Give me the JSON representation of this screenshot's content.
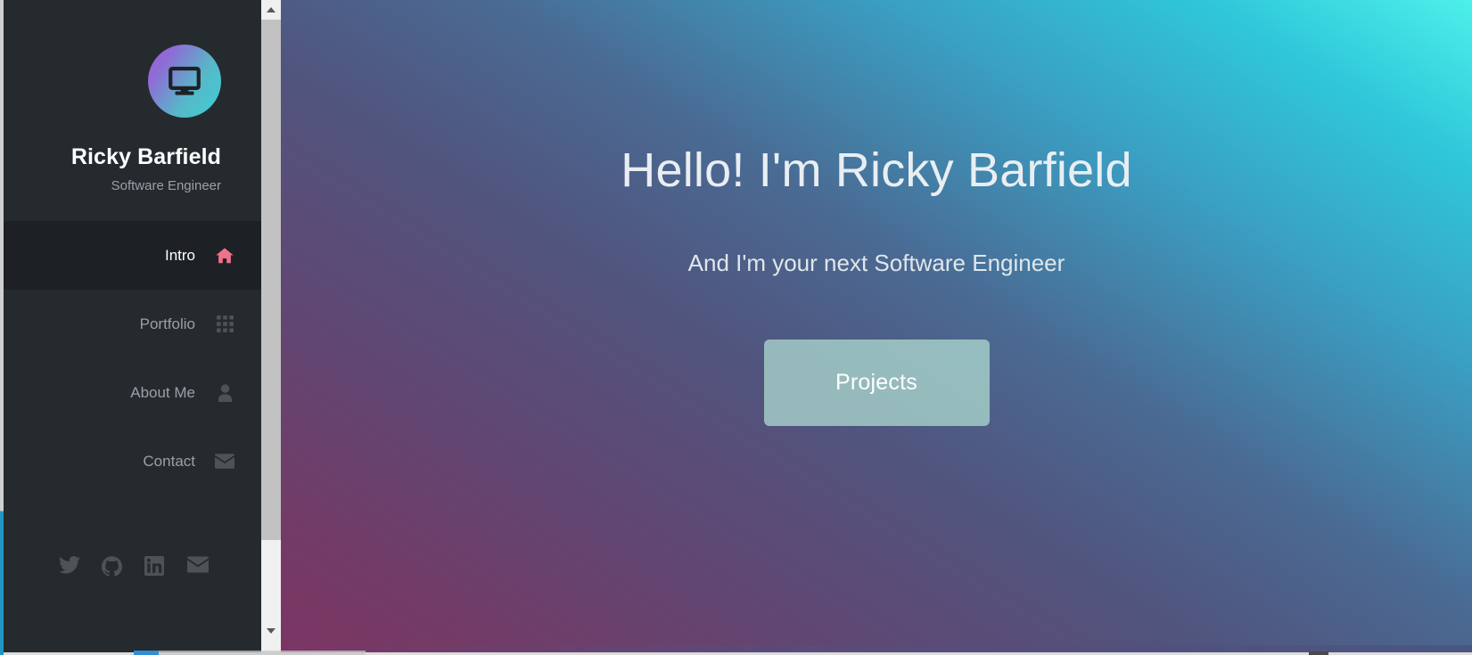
{
  "profile": {
    "name": "Ricky Barfield",
    "role": "Software Engineer",
    "avatar_icon": "desktop-monitor-icon",
    "avatar_gradient_from": "#a15fd0",
    "avatar_gradient_to": "#3ecfd4"
  },
  "nav": {
    "items": [
      {
        "label": "Intro",
        "icon": "home-icon",
        "active": true
      },
      {
        "label": "Portfolio",
        "icon": "grid-icon",
        "active": false
      },
      {
        "label": "About Me",
        "icon": "user-icon",
        "active": false
      },
      {
        "label": "Contact",
        "icon": "envelope-icon",
        "active": false
      }
    ],
    "active_icon_color": "#ef7289",
    "inactive_icon_color": "#4c5256",
    "active_bg": "#1d2125",
    "sidebar_bg": "#252a2e"
  },
  "social": {
    "items": [
      {
        "name": "twitter-icon",
        "label": "Twitter"
      },
      {
        "name": "github-icon",
        "label": "GitHub"
      },
      {
        "name": "linkedin-icon",
        "label": "LinkedIn"
      },
      {
        "name": "email-icon",
        "label": "Email"
      }
    ]
  },
  "hero": {
    "title": "Hello! I'm Ricky Barfield",
    "subtitle": "And I'm your next Software Engineer",
    "button_label": "Projects",
    "button_color": "#aad6cd",
    "gradient_start": "#7b3563",
    "gradient_mid": "#4a6a93",
    "gradient_end": "#4df0ea"
  },
  "scrollbar": {
    "up_arrow": "chevron-up-icon",
    "down_arrow": "chevron-down-icon",
    "thumb_color": "#c2c2c2",
    "track_color": "#f0f0f0"
  }
}
